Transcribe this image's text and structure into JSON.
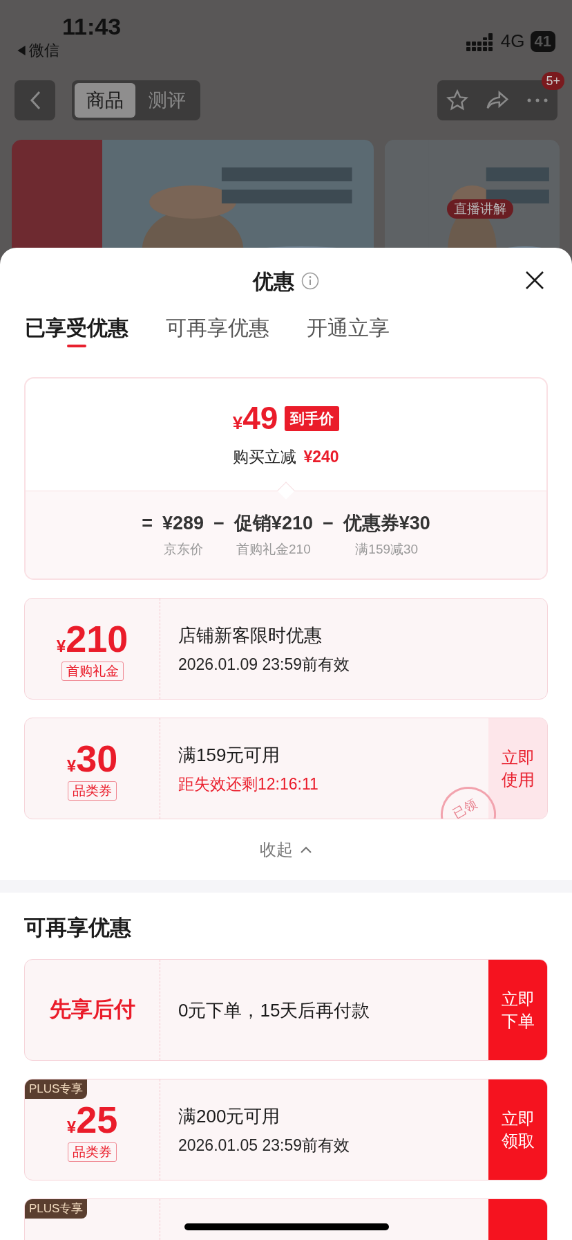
{
  "status_bar": {
    "time": "11:43",
    "back_label": "微信",
    "network": "4G",
    "battery": "41"
  },
  "nav": {
    "tabs": [
      {
        "label": "商品",
        "selected": true
      },
      {
        "label": "测评",
        "selected": false
      }
    ],
    "badge": "5+"
  },
  "banner": {
    "live_badge": "直播讲解"
  },
  "sheet": {
    "title": "优惠",
    "tabs": [
      {
        "label": "已享受优惠",
        "selected": true
      },
      {
        "label": "可再享优惠",
        "selected": false
      },
      {
        "label": "开通立享",
        "selected": false
      }
    ],
    "summary": {
      "price_symbol": "¥",
      "price": "49",
      "price_tag": "到手价",
      "saving_label": "购买立减",
      "saving": "¥240",
      "breakdown": [
        {
          "operator": "=",
          "amount": "¥289",
          "note": "京东价"
        },
        {
          "operator": "−",
          "amount": "促销¥210",
          "note": "首购礼金210"
        },
        {
          "operator": "−",
          "amount": "优惠券¥30",
          "note": "满159减30"
        }
      ]
    },
    "coupons": [
      {
        "kind": "amount",
        "symbol": "¥",
        "amount": "210",
        "tag": "首购礼金",
        "title": "店铺新客限时优惠",
        "subtitle": "2026.01.09 23:59前有效",
        "urgent": false
      },
      {
        "kind": "amount",
        "symbol": "¥",
        "amount": "30",
        "tag": "品类券",
        "title": "满159元可用",
        "subtitle": "距失效还剩12:16:11",
        "urgent": true,
        "action": "立即使用",
        "primary": false,
        "stamp": "已领"
      }
    ],
    "collapse": "收起",
    "more_title": "可再享优惠",
    "more_coupons": [
      {
        "kind": "text",
        "label": "先享后付",
        "title": "0元下单，15天后再付款",
        "action": "立即下单",
        "primary": true
      },
      {
        "kind": "amount",
        "badge": "PLUS专享",
        "symbol": "¥",
        "amount": "25",
        "tag": "品类券",
        "title": "满200元可用",
        "subtitle": "2026.01.05 23:59前有效",
        "urgent": false,
        "action": "立即领取",
        "primary": true
      },
      {
        "kind": "amount",
        "badge": "PLUS专享",
        "primary": true
      }
    ]
  }
}
